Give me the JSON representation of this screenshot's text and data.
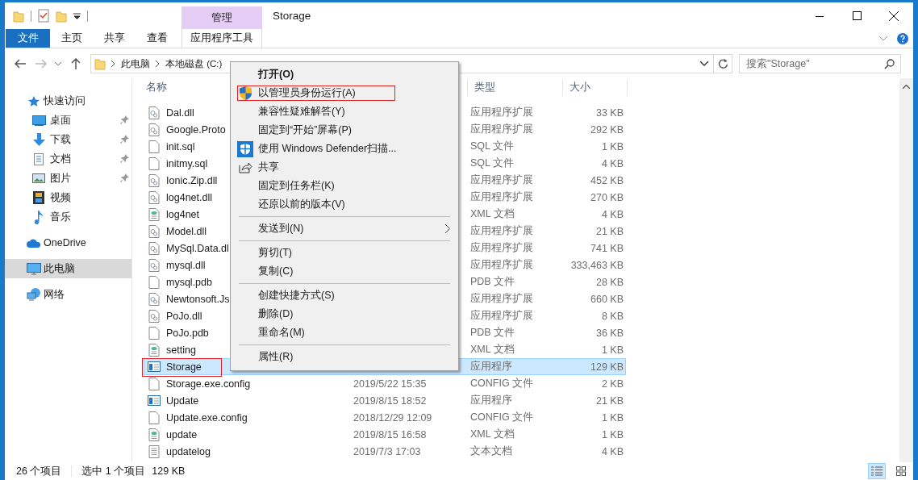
{
  "window": {
    "title": "Storage"
  },
  "ribbon": {
    "context_group": "管理",
    "tabs": [
      {
        "label": "文件",
        "kind": "file"
      },
      {
        "label": "主页",
        "kind": "normal"
      },
      {
        "label": "共享",
        "kind": "normal"
      },
      {
        "label": "查看",
        "kind": "normal"
      },
      {
        "label": "应用程序工具",
        "kind": "context"
      }
    ]
  },
  "address": {
    "crumbs": [
      "此电脑",
      "本地磁盘 (C:)"
    ]
  },
  "search": {
    "placeholder": "搜索\"Storage\""
  },
  "sidebar": {
    "items": [
      {
        "label": "快速访问",
        "kind": "star",
        "selected": false,
        "children": [
          {
            "label": "桌面",
            "kind": "desktop",
            "pinned": true,
            "selected": false
          },
          {
            "label": "下载",
            "kind": "download",
            "pinned": true,
            "selected": false
          },
          {
            "label": "文档",
            "kind": "documents",
            "pinned": true,
            "selected": false
          },
          {
            "label": "图片",
            "kind": "pictures",
            "pinned": true,
            "selected": false
          },
          {
            "label": "视频",
            "kind": "videos",
            "pinned": false,
            "selected": false
          },
          {
            "label": "音乐",
            "kind": "music",
            "pinned": false,
            "selected": false
          }
        ]
      },
      {
        "label": "OneDrive",
        "kind": "cloud",
        "selected": false
      },
      {
        "label": "此电脑",
        "kind": "pc",
        "selected": true
      },
      {
        "label": "网络",
        "kind": "network",
        "selected": false
      }
    ]
  },
  "table": {
    "columns": [
      {
        "label": "名称"
      },
      {
        "label": "类型"
      },
      {
        "label": "大小"
      }
    ],
    "rows": [
      {
        "name": "Dal.dll",
        "type": "应用程序扩展",
        "size": "33 KB",
        "kind": "dll",
        "selected": false,
        "annotated": false
      },
      {
        "name": "Google.Proto",
        "type": "应用程序扩展",
        "size": "292 KB",
        "kind": "dll",
        "selected": false,
        "annotated": false
      },
      {
        "name": "init.sql",
        "type": "SQL 文件",
        "size": "1 KB",
        "kind": "file",
        "selected": false,
        "annotated": false
      },
      {
        "name": "initmy.sql",
        "type": "SQL 文件",
        "size": "4 KB",
        "kind": "file",
        "selected": false,
        "annotated": false
      },
      {
        "name": "Ionic.Zip.dll",
        "type": "应用程序扩展",
        "size": "452 KB",
        "kind": "dll",
        "selected": false,
        "annotated": false
      },
      {
        "name": "log4net.dll",
        "type": "应用程序扩展",
        "size": "270 KB",
        "kind": "dll",
        "selected": false,
        "annotated": false
      },
      {
        "name": "log4net",
        "type": "XML 文档",
        "size": "4 KB",
        "kind": "xml",
        "selected": false,
        "annotated": false
      },
      {
        "name": "Model.dll",
        "type": "应用程序扩展",
        "size": "21 KB",
        "kind": "dll",
        "selected": false,
        "annotated": false
      },
      {
        "name": "MySql.Data.dl",
        "type": "应用程序扩展",
        "size": "741 KB",
        "kind": "dll",
        "selected": false,
        "annotated": false
      },
      {
        "name": "mysql.dll",
        "type": "应用程序扩展",
        "size": "333,463 KB",
        "kind": "dll",
        "selected": false,
        "annotated": false
      },
      {
        "name": "mysql.pdb",
        "type": "PDB 文件",
        "size": "28 KB",
        "kind": "file",
        "selected": false,
        "annotated": false
      },
      {
        "name": "Newtonsoft.Js",
        "type": "应用程序扩展",
        "size": "660 KB",
        "kind": "dll",
        "selected": false,
        "annotated": false
      },
      {
        "name": "PoJo.dll",
        "type": "应用程序扩展",
        "size": "8 KB",
        "kind": "dll",
        "selected": false,
        "annotated": false
      },
      {
        "name": "PoJo.pdb",
        "type": "PDB 文件",
        "size": "36 KB",
        "kind": "file",
        "selected": false,
        "annotated": false
      },
      {
        "name": "setting",
        "type": "XML 文档",
        "size": "1 KB",
        "kind": "xml",
        "selected": false,
        "annotated": false
      },
      {
        "name": "Storage",
        "type": "应用程序",
        "size": "129 KB",
        "kind": "exe",
        "selected": true,
        "annotated": true
      },
      {
        "name": "Storage.exe.config",
        "date": "2019/5/22 15:35",
        "type": "CONFIG 文件",
        "size": "2 KB",
        "kind": "file",
        "selected": false,
        "annotated": false
      },
      {
        "name": "Update",
        "date": "2019/8/15 18:52",
        "type": "应用程序",
        "size": "21 KB",
        "kind": "exe",
        "selected": false,
        "annotated": false
      },
      {
        "name": "Update.exe.config",
        "date": "2018/12/29 12:09",
        "type": "CONFIG 文件",
        "size": "1 KB",
        "kind": "file",
        "selected": false,
        "annotated": false
      },
      {
        "name": "update",
        "date": "2019/8/15 16:58",
        "type": "XML 文档",
        "size": "1 KB",
        "kind": "xml",
        "selected": false,
        "annotated": false
      },
      {
        "name": "updatelog",
        "date": "2019/7/3 17:03",
        "type": "文本文档",
        "size": "4 KB",
        "kind": "text",
        "selected": false,
        "annotated": false
      }
    ]
  },
  "status_bar": {
    "count": "26 个项目",
    "selection": "选中 1 个项目",
    "size": "129 KB"
  },
  "menu": {
    "items": [
      {
        "label": "打开(O)",
        "kind": "default",
        "annotated": false
      },
      {
        "label": "以管理员身份运行(A)",
        "kind": "uac",
        "annotated": true
      },
      {
        "label": "兼容性疑难解答(Y)",
        "kind": "plain",
        "annotated": false
      },
      {
        "label": "固定到“开始”屏幕(P)",
        "kind": "plain",
        "annotated": false
      },
      {
        "label": "使用 Windows Defender扫描...",
        "kind": "defender",
        "annotated": false
      },
      {
        "label": "共享",
        "kind": "share",
        "annotated": false
      },
      {
        "label": "固定到任务栏(K)",
        "kind": "plain",
        "annotated": false
      },
      {
        "label": "还原以前的版本(V)",
        "kind": "plain",
        "annotated": false
      },
      {
        "kind": "separator"
      },
      {
        "label": "发送到(N)",
        "kind": "submenu",
        "annotated": false
      },
      {
        "kind": "separator"
      },
      {
        "label": "剪切(T)",
        "kind": "plain",
        "annotated": false
      },
      {
        "label": "复制(C)",
        "kind": "plain",
        "annotated": false
      },
      {
        "kind": "separator"
      },
      {
        "label": "创建快捷方式(S)",
        "kind": "plain",
        "annotated": false
      },
      {
        "label": "删除(D)",
        "kind": "plain",
        "annotated": false
      },
      {
        "label": "重命名(M)",
        "kind": "plain",
        "annotated": false
      },
      {
        "kind": "separator"
      },
      {
        "label": "属性(R)",
        "kind": "plain",
        "annotated": false
      }
    ]
  }
}
